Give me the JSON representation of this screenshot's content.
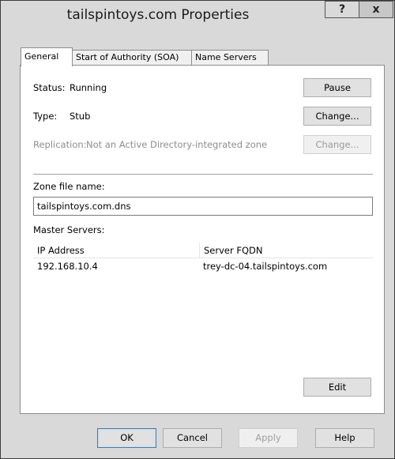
{
  "window": {
    "title": "tailspintoys.com Properties",
    "help_glyph": "?",
    "close_glyph": "x"
  },
  "tabs": [
    {
      "label": "General",
      "active": true
    },
    {
      "label": "Start of Authority (SOA)",
      "active": false
    },
    {
      "label": "Name Servers",
      "active": false
    }
  ],
  "general": {
    "status_label": "Status:",
    "status_value": "Running",
    "pause_button": "Pause",
    "type_label": "Type:",
    "type_value": "Stub",
    "change_type_button": "Change...",
    "replication_label": "Replication:",
    "replication_value": "Not an Active Directory-integrated zone",
    "change_replication_button": "Change...",
    "zone_file_label": "Zone file name:",
    "zone_file_value": "tailspintoys.com.dns",
    "master_servers_label": "Master Servers:",
    "columns": [
      "IP Address",
      "Server FQDN"
    ],
    "rows": [
      {
        "ip": "192.168.10.4",
        "fqdn": "trey-dc-04.tailspintoys.com"
      }
    ],
    "edit_button": "Edit"
  },
  "footer": {
    "ok": "OK",
    "cancel": "Cancel",
    "apply": "Apply",
    "help": "Help"
  }
}
